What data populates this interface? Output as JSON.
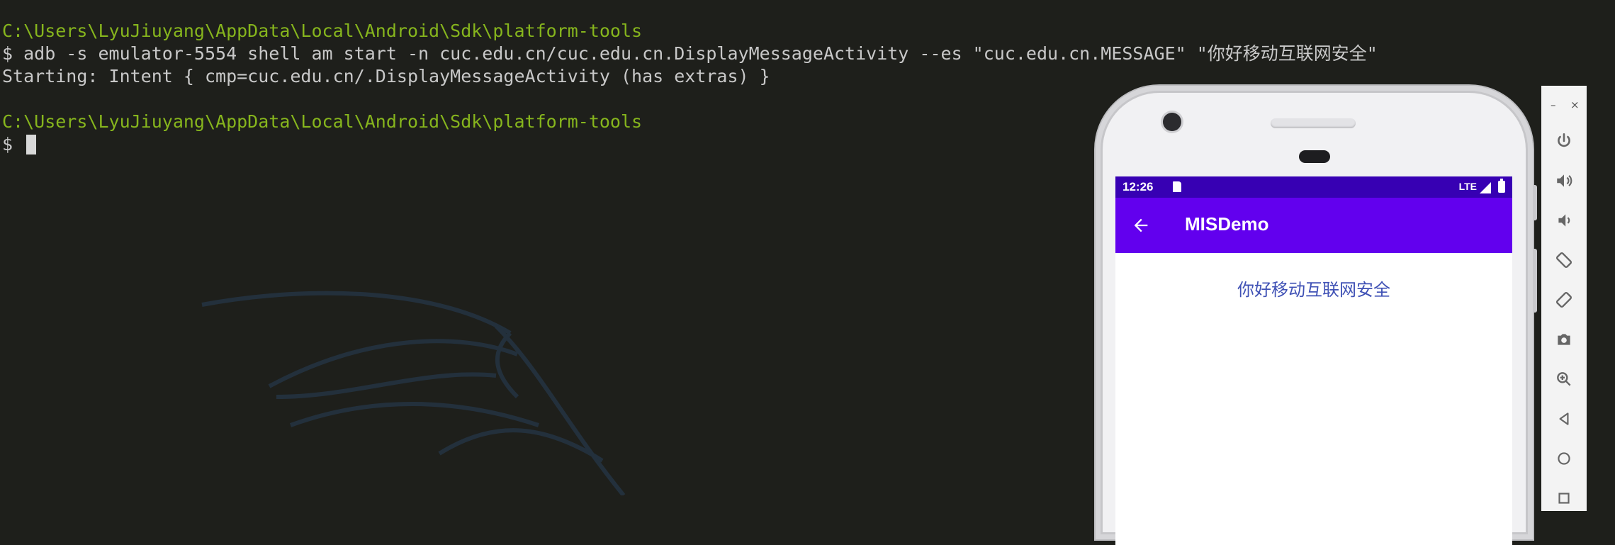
{
  "terminal": {
    "lines": [
      {
        "kind": "path",
        "text": "C:\\Users\\LyuJiuyang\\AppData\\Local\\Android\\Sdk\\platform-tools"
      },
      {
        "kind": "command",
        "text": "$ adb -s emulator-5554 shell am start -n cuc.edu.cn/cuc.edu.cn.DisplayMessageActivity --es \"cuc.edu.cn.MESSAGE\" \"你好移动互联网安全\""
      },
      {
        "kind": "output",
        "text": "Starting: Intent { cmp=cuc.edu.cn/.DisplayMessageActivity (has extras) }"
      },
      {
        "kind": "path",
        "text": "C:\\Users\\LyuJiuyang\\AppData\\Local\\Android\\Sdk\\platform-tools"
      },
      {
        "kind": "prompt",
        "text": "$ "
      }
    ]
  },
  "emulator": {
    "status_bar": {
      "time": "12:26",
      "network": "LTE"
    },
    "app_bar": {
      "title": "MISDemo"
    },
    "message": "你好移动互联网安全",
    "window_controls": {
      "minimize": "–",
      "close": "×"
    },
    "toolbar_icons": [
      "power-icon",
      "volume-up-icon",
      "volume-down-icon",
      "rotate-left-icon",
      "rotate-right-icon",
      "camera-icon",
      "zoom-icon",
      "back-icon",
      "home-icon",
      "overview-icon"
    ]
  },
  "colors": {
    "terminal_bg": "#1e1f1b",
    "path_green": "#86b51d",
    "status_bar": "#3700b3",
    "app_bar": "#6200ee",
    "message_text": "#3f51b5"
  }
}
